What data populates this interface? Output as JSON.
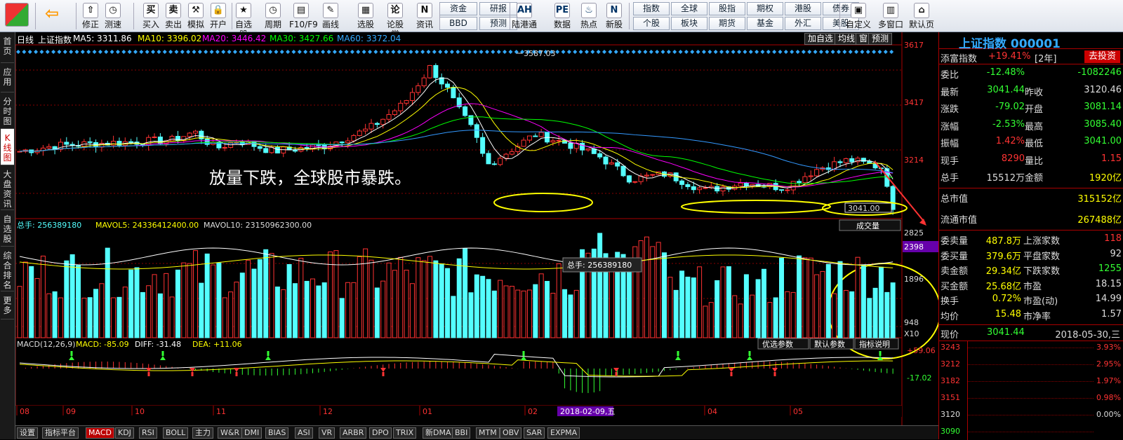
{
  "toolbar": {
    "big": [
      {
        "label": "修正",
        "icon": "⇧"
      },
      {
        "label": "测速",
        "icon": "◷"
      },
      {
        "label": "买入",
        "icon": "买"
      },
      {
        "label": "卖出",
        "icon": "卖"
      },
      {
        "label": "模拟",
        "icon": "⚒"
      },
      {
        "label": "开户",
        "icon": "🔒"
      },
      {
        "label": "自选股",
        "icon": "★"
      },
      {
        "label": "周期",
        "icon": "◷"
      },
      {
        "label": "F10/F9",
        "icon": "▤"
      },
      {
        "label": "画线",
        "icon": "✎"
      },
      {
        "label": "选股",
        "icon": "▦"
      },
      {
        "label": "论股堂",
        "icon": "论"
      },
      {
        "label": "资讯",
        "icon": "N"
      }
    ],
    "small_top": [
      "资金",
      "研报"
    ],
    "small_bot": [
      "BBD",
      "预测"
    ],
    "big2": [
      {
        "label": "陆港通",
        "icon": "AH"
      },
      {
        "label": "数据",
        "icon": "PE"
      },
      {
        "label": "热点",
        "icon": "♨"
      },
      {
        "label": "新股",
        "icon": "N"
      }
    ],
    "grid_top": [
      "指数",
      "全球",
      "股指",
      "期权",
      "港股",
      "债券"
    ],
    "grid_bot": [
      "个股",
      "板块",
      "期货",
      "基金",
      "外汇",
      "美股"
    ],
    "big3": [
      {
        "label": "自定义",
        "icon": "▣"
      },
      {
        "label": "多窗口",
        "icon": "▥"
      },
      {
        "label": "默认页",
        "icon": "⌂"
      }
    ]
  },
  "leftbar": [
    "首页",
    "应用",
    "分时图",
    "K线图",
    "大盘资讯",
    "自选股",
    "综合排名",
    "更多"
  ],
  "info": {
    "period": "日线",
    "name": "上证指数",
    "ma5": "MA5: 3311.86",
    "ma10": "MA10: 3396.02",
    "ma20": "MA20: 3446.42",
    "ma30": "MA30: 3427.66",
    "ma60": "MA60: 3372.04",
    "buttons": [
      "加自选",
      "均线",
      "窗",
      "预测"
    ]
  },
  "price_axis": [
    "3617",
    "3417",
    "3214",
    "3041.00"
  ],
  "high_label": "3587.03",
  "annotation": "放量下跌，全球股市暴跌。",
  "vol": {
    "label1": "总手: 256389180",
    "label2": "MAVOL5: 24336412400.00",
    "label3": "MAVOL10: 23150962300.00",
    "selector": "成交量",
    "axis": [
      "2825",
      "2398",
      "1896",
      "948",
      "X10"
    ],
    "tooltip": "总手: 256389180"
  },
  "macd": {
    "label1": "MACD(12,26,9)",
    "label2": "MACD: -85.09",
    "label3": "DIFF: -31.48",
    "label4": "DEA: +11.06",
    "buttons": [
      "优选参数",
      "默认参数",
      "指标说明"
    ],
    "axis": [
      "+59.06",
      "-17.02"
    ]
  },
  "xaxis": [
    "08",
    "09",
    "10",
    "11",
    "12",
    "01",
    "02",
    "04",
    "05"
  ],
  "date_marker": "2018-02-09,五",
  "bottom_tabs": [
    "设置",
    "指标平台",
    "MACD",
    "KDJ",
    "RSI",
    "BOLL",
    "主力",
    "W&R",
    "DMI",
    "BIAS",
    "ASI",
    "VR",
    "ARBR",
    "DPO",
    "TRIX",
    "新DMA",
    "BBI",
    "MTM",
    "OBV",
    "SAR",
    "EXPMA"
  ],
  "side": {
    "title": "上证指数 000001",
    "tianfu": "添富指数",
    "tianfu_pct": "+19.41%",
    "tianfu_period": "[2年]",
    "invest": "去投资",
    "rows": [
      [
        "委比",
        "-12.48%",
        "",
        "-1082246"
      ],
      [
        "最新",
        "3041.44",
        "昨收",
        "3120.46"
      ],
      [
        "涨跌",
        "-79.02",
        "开盘",
        "3081.14"
      ],
      [
        "涨幅",
        "-2.53%",
        "最高",
        "3085.40"
      ],
      [
        "振幅",
        "1.42%",
        "最低",
        "3041.00"
      ],
      [
        "现手",
        "8290",
        "量比",
        "1.15"
      ],
      [
        "总手",
        "15512万",
        "金额",
        "1920亿"
      ]
    ],
    "zsz_l": "总市值",
    "zsz_v": "315152亿",
    "ltsz_l": "流通市值",
    "ltsz_v": "267488亿",
    "rows2": [
      [
        "委卖量",
        "487.8万",
        "上涨家数",
        "118"
      ],
      [
        "委买量",
        "379.6万",
        "平盘家数",
        "92"
      ],
      [
        "卖金额",
        "29.34亿",
        "下跌家数",
        "1255"
      ],
      [
        "买金额",
        "25.68亿",
        "市盈",
        "18.15"
      ],
      [
        "换手",
        "0.72%",
        "市盈(动)",
        "14.99"
      ],
      [
        "均价",
        "15.48",
        "市净率",
        "1.57"
      ]
    ],
    "xj_l": "现价",
    "xj_v": "3041.44",
    "xj_date": "2018-05-30,三",
    "mini_axis": [
      "3243",
      "3212",
      "3182",
      "3151",
      "3120",
      "3090"
    ],
    "mini_pct": [
      "3.93%",
      "2.95%",
      "1.97%",
      "0.98%",
      "0.00%"
    ]
  },
  "colors": {
    "up": "#ff3232",
    "down": "#54ffff",
    "ma5": "#ffffff",
    "ma10": "#ffff00",
    "ma20": "#ff00ff",
    "ma30": "#00ff00",
    "ma60": "#3399ff",
    "ellipse": "#ffff00"
  }
}
